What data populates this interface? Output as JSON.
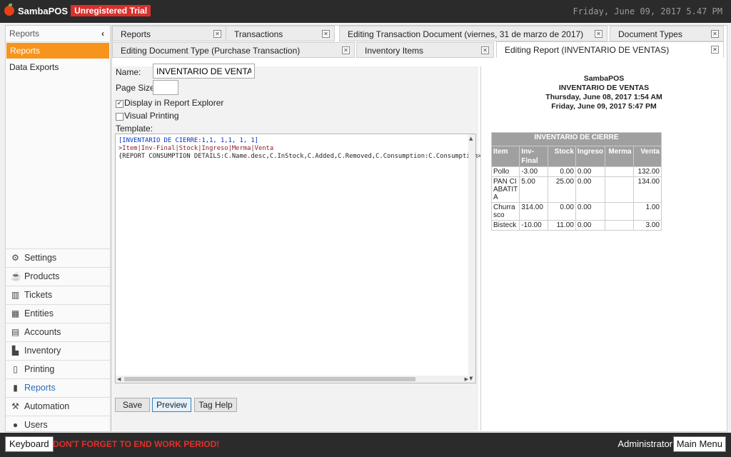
{
  "app": {
    "name": "SambaPOS",
    "trial_badge": "Unregistered Trial",
    "clock": "Friday, June 09, 2017 5.47 PM"
  },
  "sidebar": {
    "header": "Reports",
    "items": [
      {
        "label": "Reports"
      },
      {
        "label": "Data Exports"
      }
    ],
    "nav": [
      {
        "label": "Settings",
        "icon": "gear-icon"
      },
      {
        "label": "Products",
        "icon": "coffee-icon"
      },
      {
        "label": "Tickets",
        "icon": "tickets-icon"
      },
      {
        "label": "Entities",
        "icon": "table-icon"
      },
      {
        "label": "Accounts",
        "icon": "calculator-icon"
      },
      {
        "label": "Inventory",
        "icon": "inventory-icon"
      },
      {
        "label": "Printing",
        "icon": "document-icon"
      },
      {
        "label": "Reports",
        "icon": "bar-chart-icon"
      },
      {
        "label": "Automation",
        "icon": "gavel-icon"
      },
      {
        "label": "Users",
        "icon": "user-icon"
      }
    ]
  },
  "tabs": {
    "row1": [
      "Reports",
      "Transactions",
      "Editing Transaction Document (viernes, 31 de marzo de 2017)",
      "Document Types"
    ],
    "row2": [
      "Editing Document Type (Purchase Transaction)",
      "Inventory Items",
      "Editing Report (INVENTARIO DE VENTAS)"
    ]
  },
  "form": {
    "name_label": "Name:",
    "name_value": "INVENTARIO DE VENTAS",
    "page_size_label": "Page Size:",
    "page_size_value": "",
    "display_label": "Display in Report Explorer",
    "display_checked": true,
    "visual_label": "Visual Printing",
    "visual_checked": false,
    "template_label": "Template:",
    "template_lines": [
      "[INVENTARIO DE CIERRE:1,1, 1,1, 1, 1]",
      ">Item|Inv-Final|Stock|Ingreso|Merma|Venta",
      "{REPORT CONSUMPTION DETAILS:C.Name.desc,C.InStock,C.Added,C.Removed,C.Consumption:C.Consumption>"
    ],
    "buttons": {
      "save": "Save",
      "preview": "Preview",
      "tag_help": "Tag Help"
    }
  },
  "preview": {
    "header_lines": [
      "SambaPOS",
      "INVENTARIO DE VENTAS",
      "Thursday, June 08, 2017 1:54 AM",
      "Friday, June 09, 2017 5:47 PM"
    ],
    "table": {
      "title": "INVENTARIO DE CIERRE",
      "columns": [
        "Item",
        "Inv-Final",
        "Stock",
        "Ingreso",
        "Merma",
        "Venta"
      ],
      "rows": [
        [
          "Pollo",
          "-3.00",
          "0.00",
          "0.00",
          "",
          "132.00"
        ],
        [
          "PAN CIABATITA",
          "5.00",
          "25.00",
          "0.00",
          "",
          "134.00"
        ],
        [
          "Churrasco",
          "314.00",
          "0.00",
          "0.00",
          "",
          "1.00"
        ],
        [
          "Bisteck",
          "-10.00",
          "11.00",
          "0.00",
          "",
          "3.00"
        ]
      ]
    }
  },
  "footer": {
    "keyboard": "Keyboard",
    "warning": "DON'T FORGET TO END WORK PERIOD!",
    "user": "Administrator",
    "main_menu": "Main Menu"
  }
}
